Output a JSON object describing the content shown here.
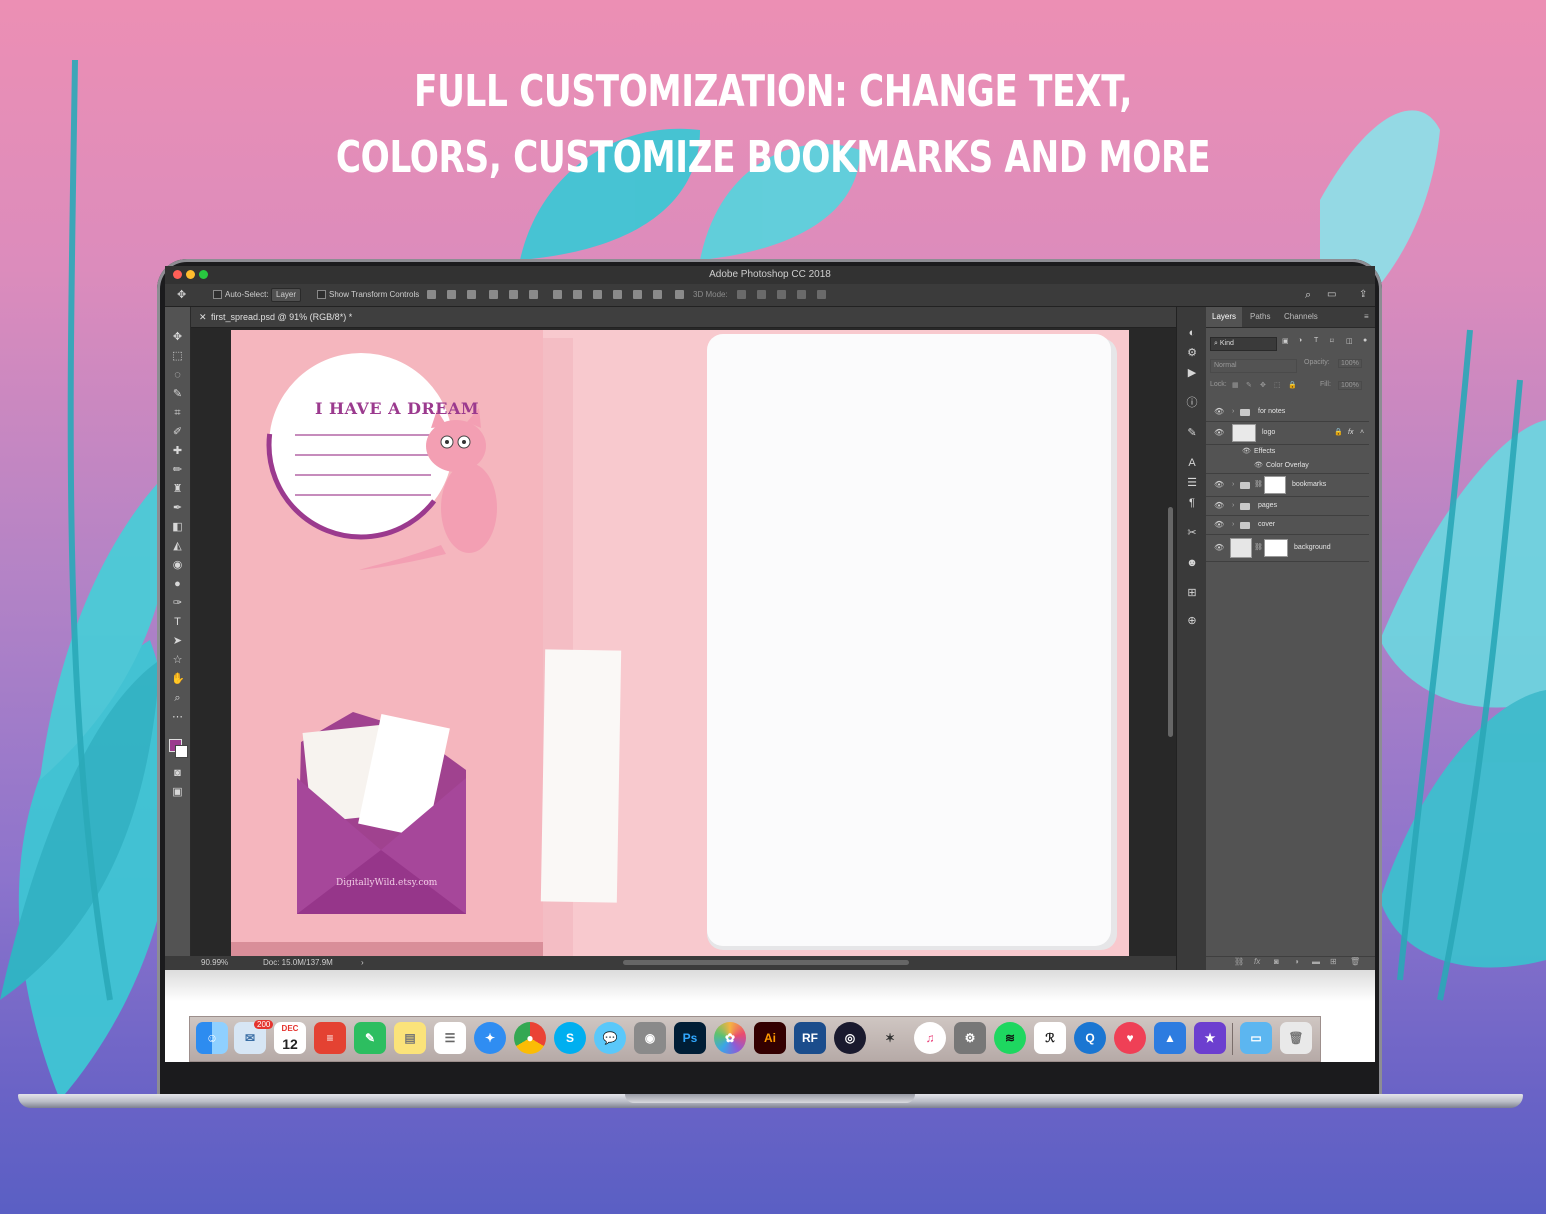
{
  "headline": {
    "line1": "FULL CUSTOMIZATION: CHANGE TEXT,",
    "line2": "COLORS, CUSTOMIZE BOOKMARKS AND MORE"
  },
  "app": {
    "window_title": "Adobe Photoshop CC 2018"
  },
  "options_bar": {
    "auto_select_label": "Auto-Select:",
    "auto_select_value": "Layer",
    "show_transform_label": "Show Transform Controls",
    "mode_3d_label": "3D Mode:"
  },
  "document": {
    "tab_label": "first_spread.psd @ 91% (RGB/8*) *",
    "zoom": "90.99%",
    "doc_size": "Doc: 15.0M/137.9M"
  },
  "artwork": {
    "heading": "I HAVE A DREAM",
    "envelope_text": "DigitallyWild.etsy.com"
  },
  "layers_panel": {
    "tabs": [
      "Layers",
      "Paths",
      "Channels"
    ],
    "filter_value": "Kind",
    "blend_mode": "Normal",
    "opacity_label": "Opacity:",
    "opacity_value": "100%",
    "lock_label": "Lock:",
    "fill_label": "Fill:",
    "fill_value": "100%",
    "layers": [
      {
        "name": "for notes"
      },
      {
        "name": "logo"
      },
      {
        "name": "Effects"
      },
      {
        "name": "Color Overlay"
      },
      {
        "name": "bookmarks"
      },
      {
        "name": "pages"
      },
      {
        "name": "cover"
      },
      {
        "name": "background"
      }
    ],
    "fx_label": "fx"
  },
  "dock": {
    "mail_badge": "200",
    "calendar_month": "DEC",
    "calendar_day": "12",
    "photoshop_label": "Ps",
    "illustrator_label": "Ai",
    "rf_label": "RF"
  },
  "colors": {
    "accent_purple": "#9b3a8e",
    "canvas_pink": "#f8c9ce",
    "leaf_cyan": "#36c3cf"
  }
}
